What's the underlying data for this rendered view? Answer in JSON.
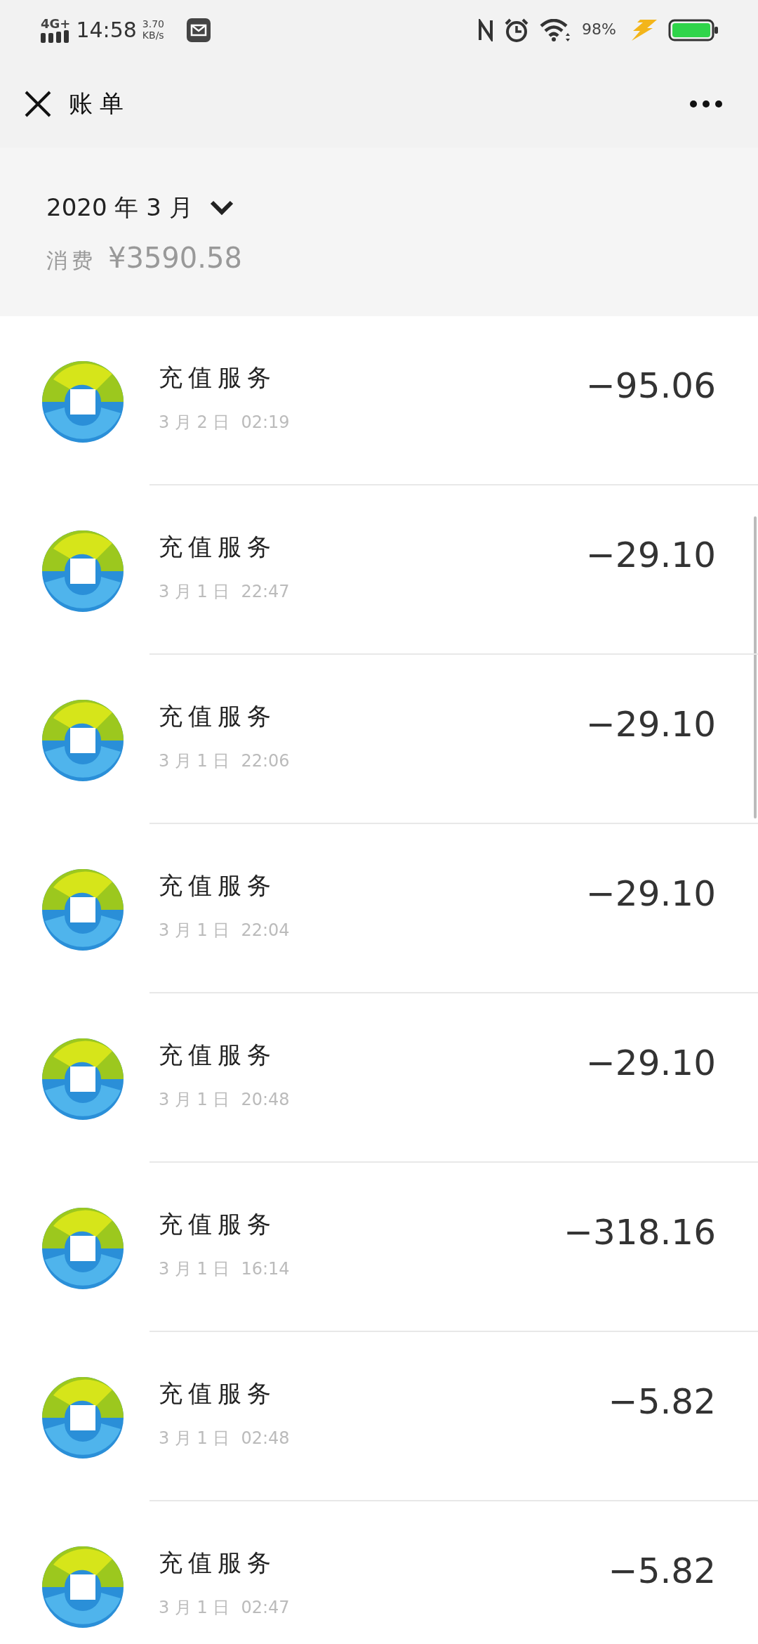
{
  "status_bar": {
    "network": "4G+",
    "time": "14:58",
    "speed_value": "3.70",
    "speed_unit": "KB/s",
    "battery": "98%"
  },
  "header": {
    "title": "账单"
  },
  "summary": {
    "month": "2020 年 3 月",
    "label": "消费",
    "total": "¥3590.58"
  },
  "transactions": [
    {
      "title": "充值服务",
      "date": "3 月 2 日",
      "time": "02:19",
      "amount": "−95.06"
    },
    {
      "title": "充值服务",
      "date": "3 月 1 日",
      "time": "22:47",
      "amount": "−29.10"
    },
    {
      "title": "充值服务",
      "date": "3 月 1 日",
      "time": "22:06",
      "amount": "−29.10"
    },
    {
      "title": "充值服务",
      "date": "3 月 1 日",
      "time": "22:04",
      "amount": "−29.10"
    },
    {
      "title": "充值服务",
      "date": "3 月 1 日",
      "time": "20:48",
      "amount": "−29.10"
    },
    {
      "title": "充值服务",
      "date": "3 月 1 日",
      "time": "16:14",
      "amount": "−318.16"
    },
    {
      "title": "充值服务",
      "date": "3 月 1 日",
      "time": "02:48",
      "amount": "−5.82"
    },
    {
      "title": "充值服务",
      "date": "3 月 1 日",
      "time": "02:47",
      "amount": "−5.82"
    }
  ]
}
